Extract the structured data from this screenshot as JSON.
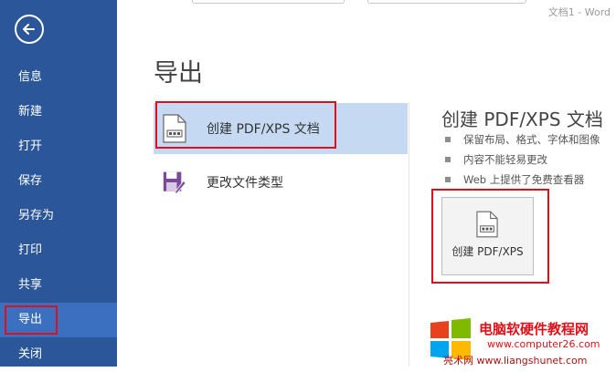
{
  "window": {
    "title": "文档1 - Word"
  },
  "sidebar": {
    "items": [
      {
        "label": "信息"
      },
      {
        "label": "新建"
      },
      {
        "label": "打开"
      },
      {
        "label": "保存"
      },
      {
        "label": "另存为"
      },
      {
        "label": "打印"
      },
      {
        "label": "共享"
      },
      {
        "label": "导出"
      },
      {
        "label": "关闭"
      }
    ],
    "active_item": "导出"
  },
  "page": {
    "title": "导出"
  },
  "options": [
    {
      "label": "创建 PDF/XPS 文档",
      "icon": "pdf-document-icon",
      "selected": true
    },
    {
      "label": "更改文件类型",
      "icon": "change-file-type-icon",
      "selected": false
    }
  ],
  "detail": {
    "title": "创建 PDF/XPS 文档",
    "bullets": [
      "保留布局、格式、字体和图像",
      "内容不能轻易更改",
      "Web 上提供了免费查看器"
    ],
    "button_label": "创建 PDF/XPS"
  },
  "watermark": {
    "title": "电脑软硬件教程网",
    "url": "www.computer26.com",
    "url2": "亮术网 www.liangshunet.com"
  },
  "colors": {
    "sidebar": "#2b579a",
    "highlight": "#e0101a",
    "selected": "#c5daf2"
  }
}
